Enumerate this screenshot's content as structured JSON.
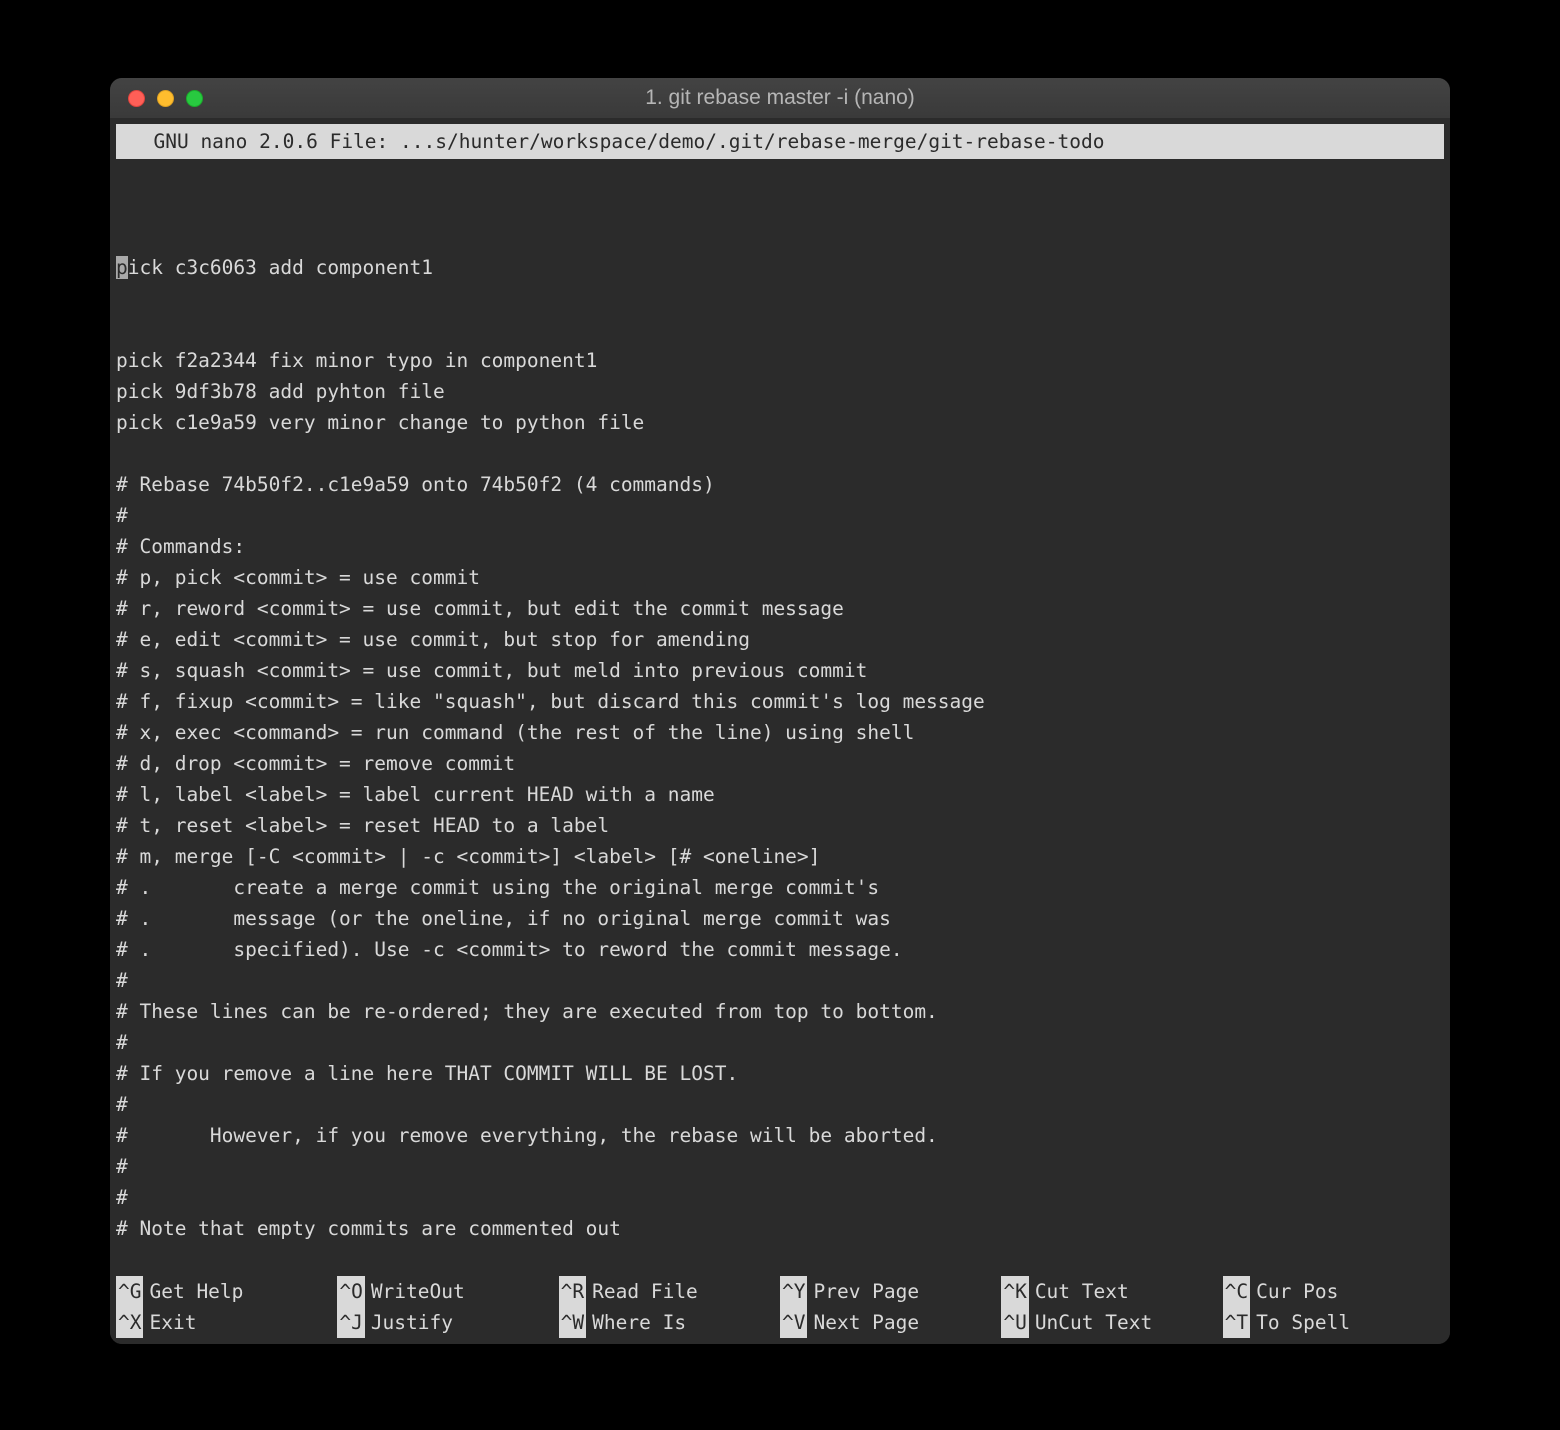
{
  "window": {
    "title": "1. git rebase master -i (nano)"
  },
  "nano": {
    "header_prefix": "  GNU nano 2.0.6 File: ",
    "file_path": "...s/hunter/workspace/demo/.git/rebase-merge/git-rebase-todo"
  },
  "editor": {
    "cursor_char": "p",
    "line1_rest": "ick c3c6063 add component1",
    "lines": [
      "pick f2a2344 fix minor typo in component1",
      "pick 9df3b78 add pyhton file",
      "pick c1e9a59 very minor change to python file",
      "",
      "# Rebase 74b50f2..c1e9a59 onto 74b50f2 (4 commands)",
      "#",
      "# Commands:",
      "# p, pick <commit> = use commit",
      "# r, reword <commit> = use commit, but edit the commit message",
      "# e, edit <commit> = use commit, but stop for amending",
      "# s, squash <commit> = use commit, but meld into previous commit",
      "# f, fixup <commit> = like \"squash\", but discard this commit's log message",
      "# x, exec <command> = run command (the rest of the line) using shell",
      "# d, drop <commit> = remove commit",
      "# l, label <label> = label current HEAD with a name",
      "# t, reset <label> = reset HEAD to a label",
      "# m, merge [-C <commit> | -c <commit>] <label> [# <oneline>]",
      "# .       create a merge commit using the original merge commit's",
      "# .       message (or the oneline, if no original merge commit was",
      "# .       specified). Use -c <commit> to reword the commit message.",
      "#",
      "# These lines can be re-ordered; they are executed from top to bottom.",
      "#",
      "# If you remove a line here THAT COMMIT WILL BE LOST.",
      "#",
      "#\tHowever, if you remove everything, the rebase will be aborted.",
      "#",
      "#",
      "# Note that empty commits are commented out"
    ]
  },
  "shortcuts": {
    "row1": [
      {
        "key": "^G",
        "label": "Get Help"
      },
      {
        "key": "^O",
        "label": "WriteOut"
      },
      {
        "key": "^R",
        "label": "Read File"
      },
      {
        "key": "^Y",
        "label": "Prev Page"
      },
      {
        "key": "^K",
        "label": "Cut Text"
      },
      {
        "key": "^C",
        "label": "Cur Pos"
      }
    ],
    "row2": [
      {
        "key": "^X",
        "label": "Exit"
      },
      {
        "key": "^J",
        "label": "Justify"
      },
      {
        "key": "^W",
        "label": "Where Is"
      },
      {
        "key": "^V",
        "label": "Next Page"
      },
      {
        "key": "^U",
        "label": "UnCut Text"
      },
      {
        "key": "^T",
        "label": "To Spell"
      }
    ]
  }
}
